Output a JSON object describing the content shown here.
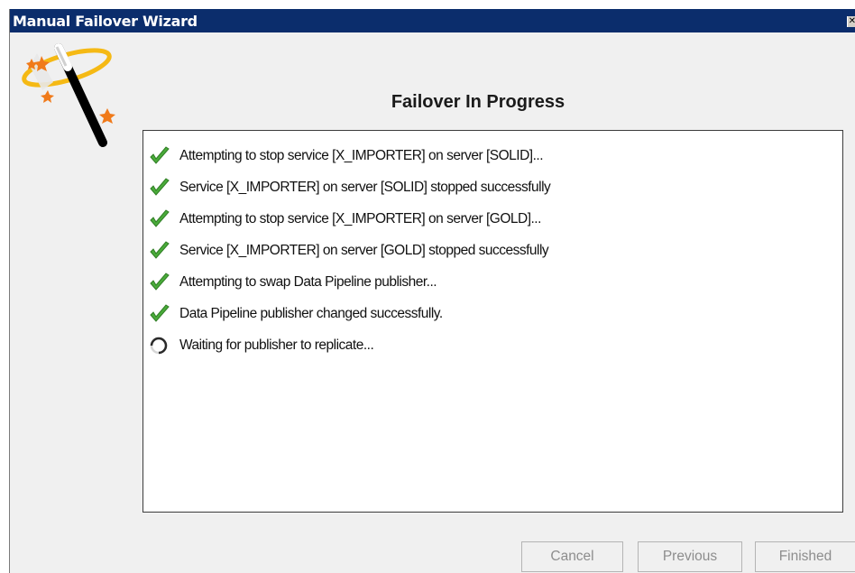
{
  "window": {
    "title": "Manual Failover Wizard",
    "close_glyph": "✕"
  },
  "heading": "Failover In Progress",
  "log_entries": [
    {
      "status": "success",
      "icon": "checkmark-icon",
      "text": "Attempting to stop service [X_IMPORTER] on server [SOLID]..."
    },
    {
      "status": "success",
      "icon": "checkmark-icon",
      "text": "Service [X_IMPORTER] on server [SOLID] stopped successfully"
    },
    {
      "status": "success",
      "icon": "checkmark-icon",
      "text": "Attempting to stop service [X_IMPORTER] on server [GOLD]..."
    },
    {
      "status": "success",
      "icon": "checkmark-icon",
      "text": "Service [X_IMPORTER] on server [GOLD] stopped successfully"
    },
    {
      "status": "success",
      "icon": "checkmark-icon",
      "text": "Attempting to swap Data Pipeline publisher..."
    },
    {
      "status": "success",
      "icon": "checkmark-icon",
      "text": "Data Pipeline publisher changed successfully."
    },
    {
      "status": "in-progress",
      "icon": "spinner-icon",
      "text": "Waiting for publisher to replicate..."
    }
  ],
  "buttons": {
    "cancel": "Cancel",
    "previous": "Previous",
    "finished": "Finished"
  },
  "colors": {
    "titlebar": "#0b2d6c",
    "check": "#4aab3a",
    "disabled_text": "#8d8d8d"
  },
  "icons": {
    "wizard": "magic-wand-icon"
  }
}
